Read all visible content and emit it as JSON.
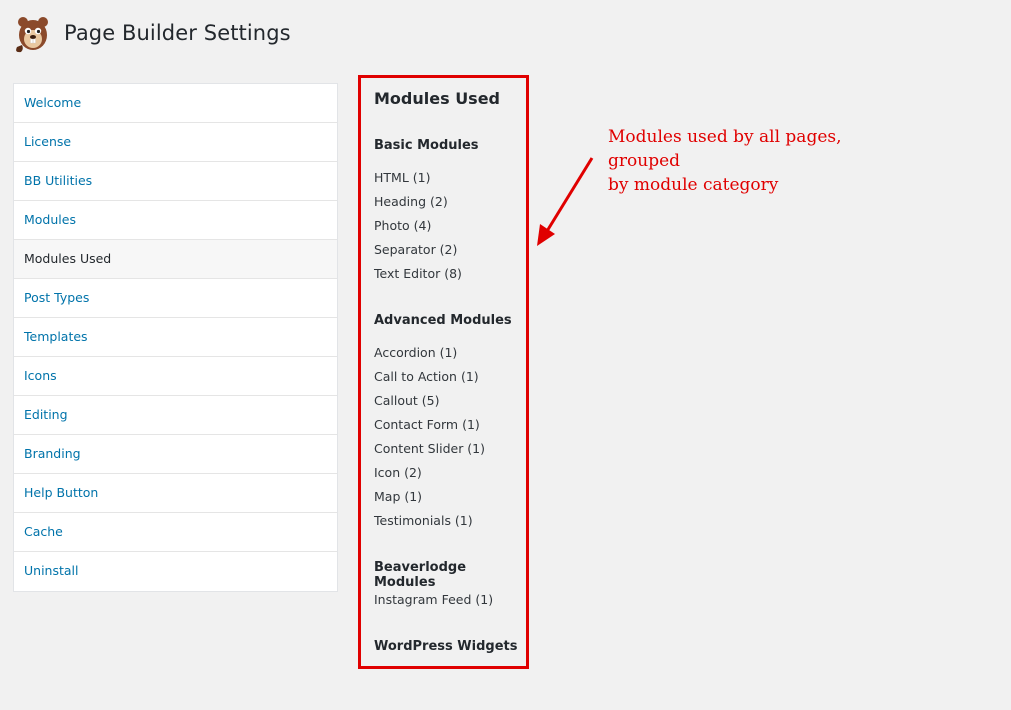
{
  "header": {
    "title": "Page Builder Settings",
    "logo_icon": "beaver-logo-icon"
  },
  "sidebar": {
    "items": [
      {
        "label": "Welcome",
        "active": false
      },
      {
        "label": "License",
        "active": false
      },
      {
        "label": "BB Utilities",
        "active": false
      },
      {
        "label": "Modules",
        "active": false
      },
      {
        "label": "Modules Used",
        "active": true
      },
      {
        "label": "Post Types",
        "active": false
      },
      {
        "label": "Templates",
        "active": false
      },
      {
        "label": "Icons",
        "active": false
      },
      {
        "label": "Editing",
        "active": false
      },
      {
        "label": "Branding",
        "active": false
      },
      {
        "label": "Help Button",
        "active": false
      },
      {
        "label": "Cache",
        "active": false
      },
      {
        "label": "Uninstall",
        "active": false
      }
    ]
  },
  "main": {
    "title": "Modules Used",
    "categories": [
      {
        "name": "Basic Modules",
        "modules": [
          "HTML (1)",
          "Heading (2)",
          "Photo (4)",
          "Separator (2)",
          "Text Editor (8)"
        ]
      },
      {
        "name": "Advanced Modules",
        "modules": [
          "Accordion (1)",
          "Call to Action (1)",
          "Callout (5)",
          "Contact Form (1)",
          "Content Slider (1)",
          "Icon (2)",
          "Map (1)",
          "Testimonials (1)"
        ]
      },
      {
        "name": "Beaverlodge Modules",
        "modules": [
          "Instagram Feed (1)"
        ]
      },
      {
        "name": "WordPress Widgets",
        "modules": []
      }
    ]
  },
  "annotation": {
    "line1": "Modules used by all pages, grouped",
    "line2": "by module category"
  },
  "colors": {
    "link": "#0073aa",
    "highlight_border": "#e00000",
    "annotation_text": "#e00000",
    "background": "#f1f1f1"
  }
}
